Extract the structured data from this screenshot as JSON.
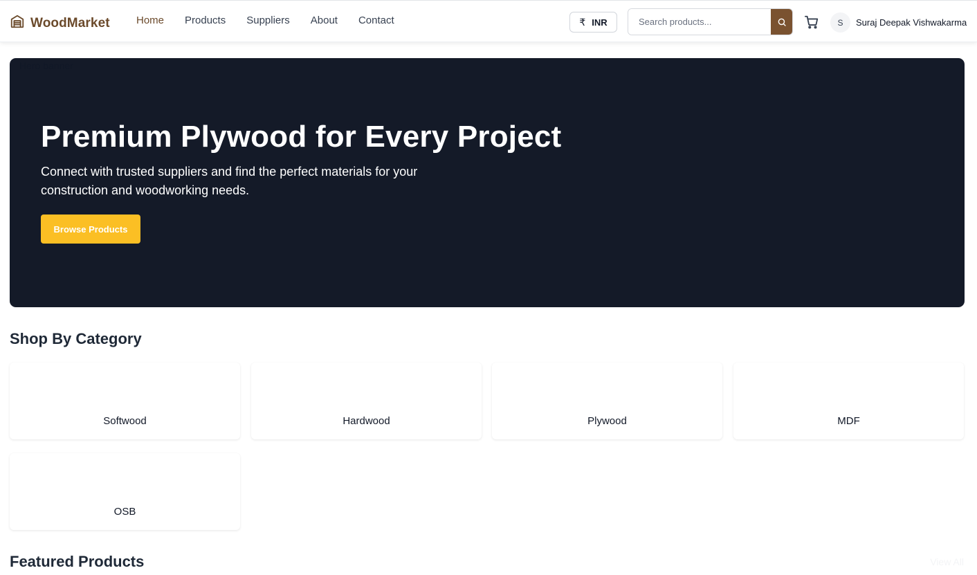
{
  "brand": {
    "name": "WoodMarket",
    "icon": "warehouse-icon"
  },
  "nav": {
    "items": [
      {
        "label": "Home",
        "active": true
      },
      {
        "label": "Products",
        "active": false
      },
      {
        "label": "Suppliers",
        "active": false
      },
      {
        "label": "About",
        "active": false
      },
      {
        "label": "Contact",
        "active": false
      }
    ]
  },
  "currency": {
    "symbol": "₹",
    "code": "INR"
  },
  "search": {
    "placeholder": "Search products...",
    "value": ""
  },
  "user": {
    "initial": "S",
    "name": "Suraj Deepak Vishwakarma"
  },
  "hero": {
    "image_alt": "Hero banner",
    "title": "Premium Plywood for Every Project",
    "subtitle": "Connect with trusted suppliers and find the perfect materials for your construction and woodworking needs.",
    "cta": "Browse Products"
  },
  "categories": {
    "title": "Shop By Category",
    "items": [
      "Softwood",
      "Hardwood",
      "Plywood",
      "MDF",
      "OSB"
    ]
  },
  "featured": {
    "title": "Featured Products",
    "view_all": "View All"
  },
  "colors": {
    "brand": "#6b4a2b",
    "search_button": "#7a5230",
    "hero_background": "#141a28",
    "cta": "#fbbf24"
  }
}
